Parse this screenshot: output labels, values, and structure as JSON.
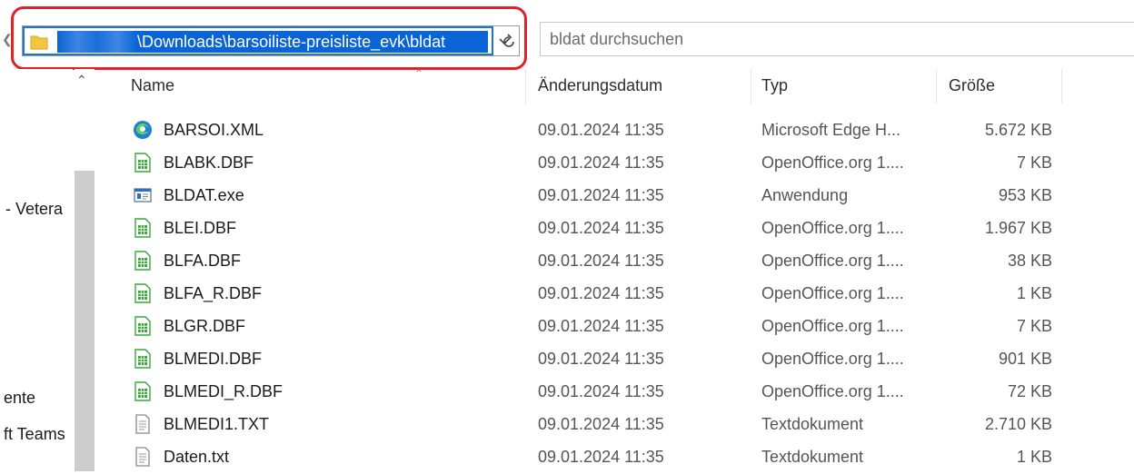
{
  "address": {
    "path": "\\Downloads\\barsoiliste-preisliste_evk\\bldat"
  },
  "search": {
    "placeholder": "bldat durchsuchen"
  },
  "nav": {
    "items": [
      "- Vetera",
      "ente",
      "ft Teams"
    ]
  },
  "columns": {
    "name": "Name",
    "date": "Änderungsdatum",
    "type": "Typ",
    "size": "Größe"
  },
  "files": [
    {
      "name": "BARSOI.XML",
      "date": "09.01.2024 11:35",
      "type": "Microsoft Edge H...",
      "size": "5.672 KB",
      "icon": "edge-icon"
    },
    {
      "name": "BLABK.DBF",
      "date": "09.01.2024 11:35",
      "type": "OpenOffice.org 1....",
      "size": "7 KB",
      "icon": "spreadsheet-icon"
    },
    {
      "name": "BLDAT.exe",
      "date": "09.01.2024 11:35",
      "type": "Anwendung",
      "size": "953 KB",
      "icon": "application-icon"
    },
    {
      "name": "BLEI.DBF",
      "date": "09.01.2024 11:35",
      "type": "OpenOffice.org 1....",
      "size": "1.967 KB",
      "icon": "spreadsheet-icon"
    },
    {
      "name": "BLFA.DBF",
      "date": "09.01.2024 11:35",
      "type": "OpenOffice.org 1....",
      "size": "38 KB",
      "icon": "spreadsheet-icon"
    },
    {
      "name": "BLFA_R.DBF",
      "date": "09.01.2024 11:35",
      "type": "OpenOffice.org 1....",
      "size": "1 KB",
      "icon": "spreadsheet-icon"
    },
    {
      "name": "BLGR.DBF",
      "date": "09.01.2024 11:35",
      "type": "OpenOffice.org 1....",
      "size": "7 KB",
      "icon": "spreadsheet-icon"
    },
    {
      "name": "BLMEDI.DBF",
      "date": "09.01.2024 11:35",
      "type": "OpenOffice.org 1....",
      "size": "901 KB",
      "icon": "spreadsheet-icon"
    },
    {
      "name": "BLMEDI_R.DBF",
      "date": "09.01.2024 11:35",
      "type": "OpenOffice.org 1....",
      "size": "72 KB",
      "icon": "spreadsheet-icon"
    },
    {
      "name": "BLMEDI1.TXT",
      "date": "09.01.2024 11:35",
      "type": "Textdokument",
      "size": "2.710 KB",
      "icon": "text-document-icon"
    },
    {
      "name": "Daten.txt",
      "date": "09.01.2024 11:35",
      "type": "Textdokument",
      "size": "1 KB",
      "icon": "text-document-icon"
    }
  ],
  "colors": {
    "highlight": "#e0202a",
    "selection": "#0a64d6",
    "spreadsheet": "#3aa63a"
  }
}
